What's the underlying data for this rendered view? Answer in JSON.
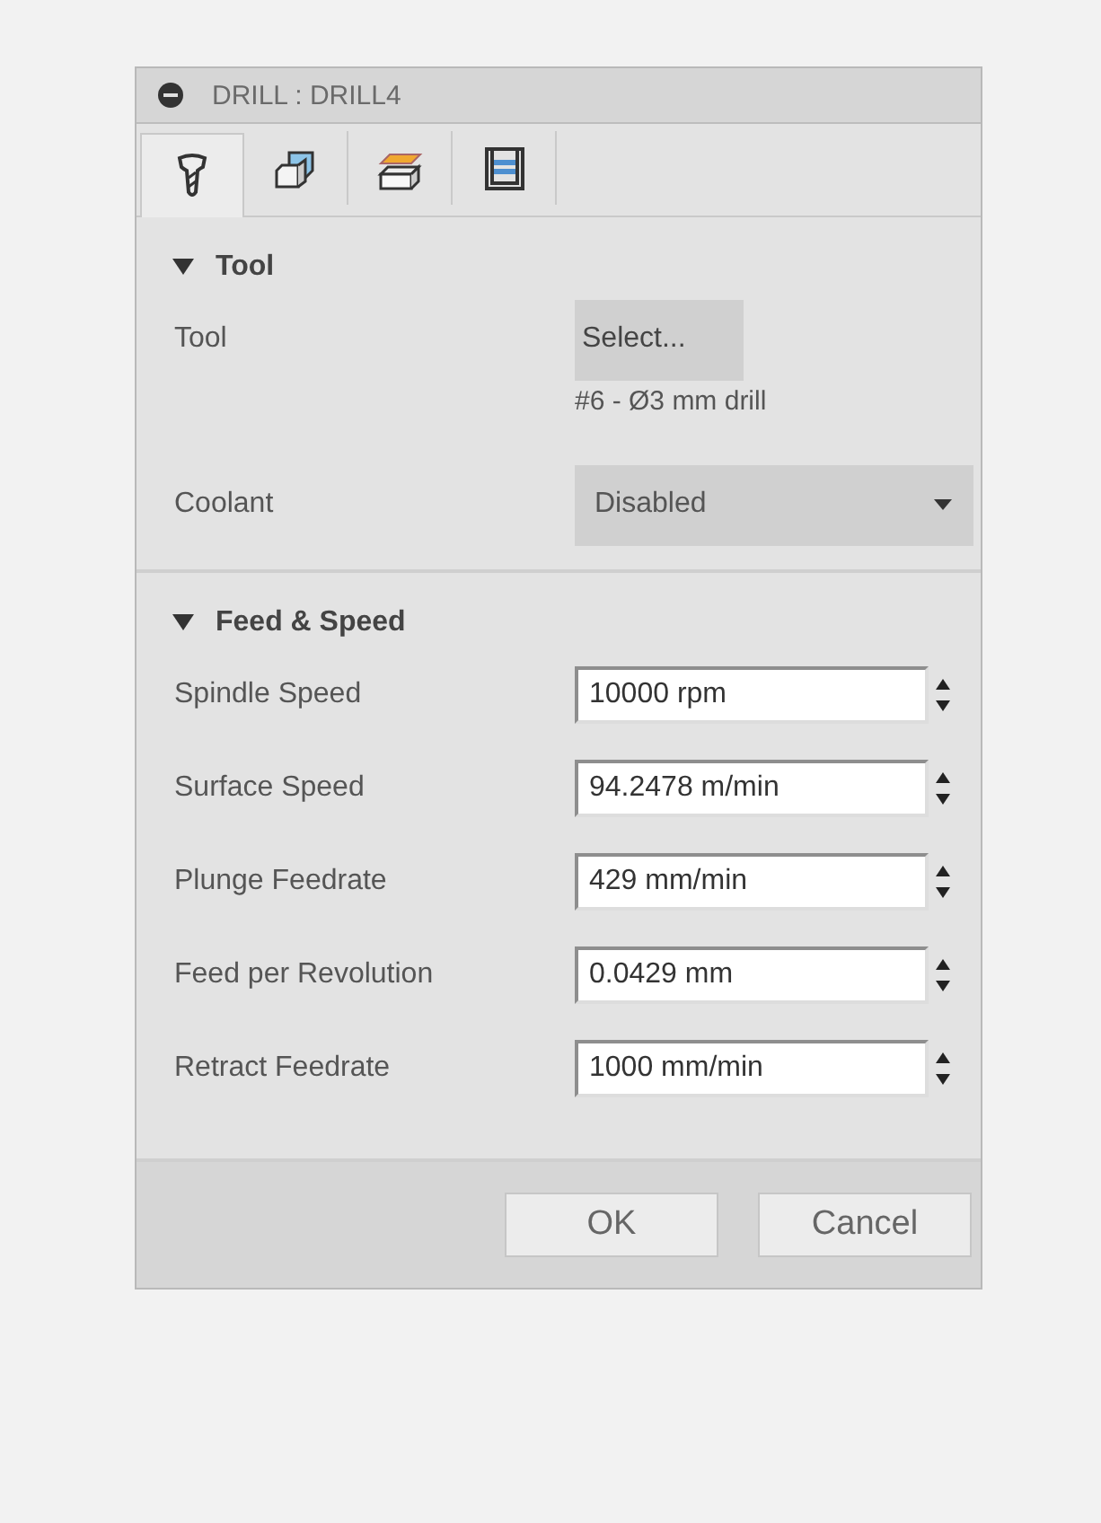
{
  "window": {
    "title": "DRILL : DRILL4"
  },
  "tabs": [
    {
      "kind": "tool",
      "selected": true
    },
    {
      "kind": "geometry",
      "selected": false
    },
    {
      "kind": "heights",
      "selected": false
    },
    {
      "kind": "passes",
      "selected": false
    }
  ],
  "sections": [
    {
      "title": "Tool",
      "expanded": true,
      "rows": [
        {
          "kind": "button",
          "label": "Tool",
          "value": "Select..."
        },
        {
          "kind": "text",
          "value": "#6 - Ø3 mm drill"
        },
        {
          "kind": "dropdown",
          "label": "Coolant",
          "value": "Disabled"
        }
      ]
    },
    {
      "title": "Feed & Speed",
      "expanded": true,
      "rows": [
        {
          "kind": "spinner",
          "label": "Spindle Speed",
          "value": "10000 rpm"
        },
        {
          "kind": "spinner",
          "label": "Surface Speed",
          "value": "94.2478 m/min"
        },
        {
          "kind": "spinner",
          "label": "Plunge Feedrate",
          "value": "429 mm/min"
        },
        {
          "kind": "spinner",
          "label": "Feed per Revolution",
          "value": "0.0429 mm"
        },
        {
          "kind": "spinner",
          "label": "Retract Feedrate",
          "value": "1000 mm/min"
        }
      ]
    }
  ],
  "buttons": [
    "OK",
    "Cancel"
  ]
}
